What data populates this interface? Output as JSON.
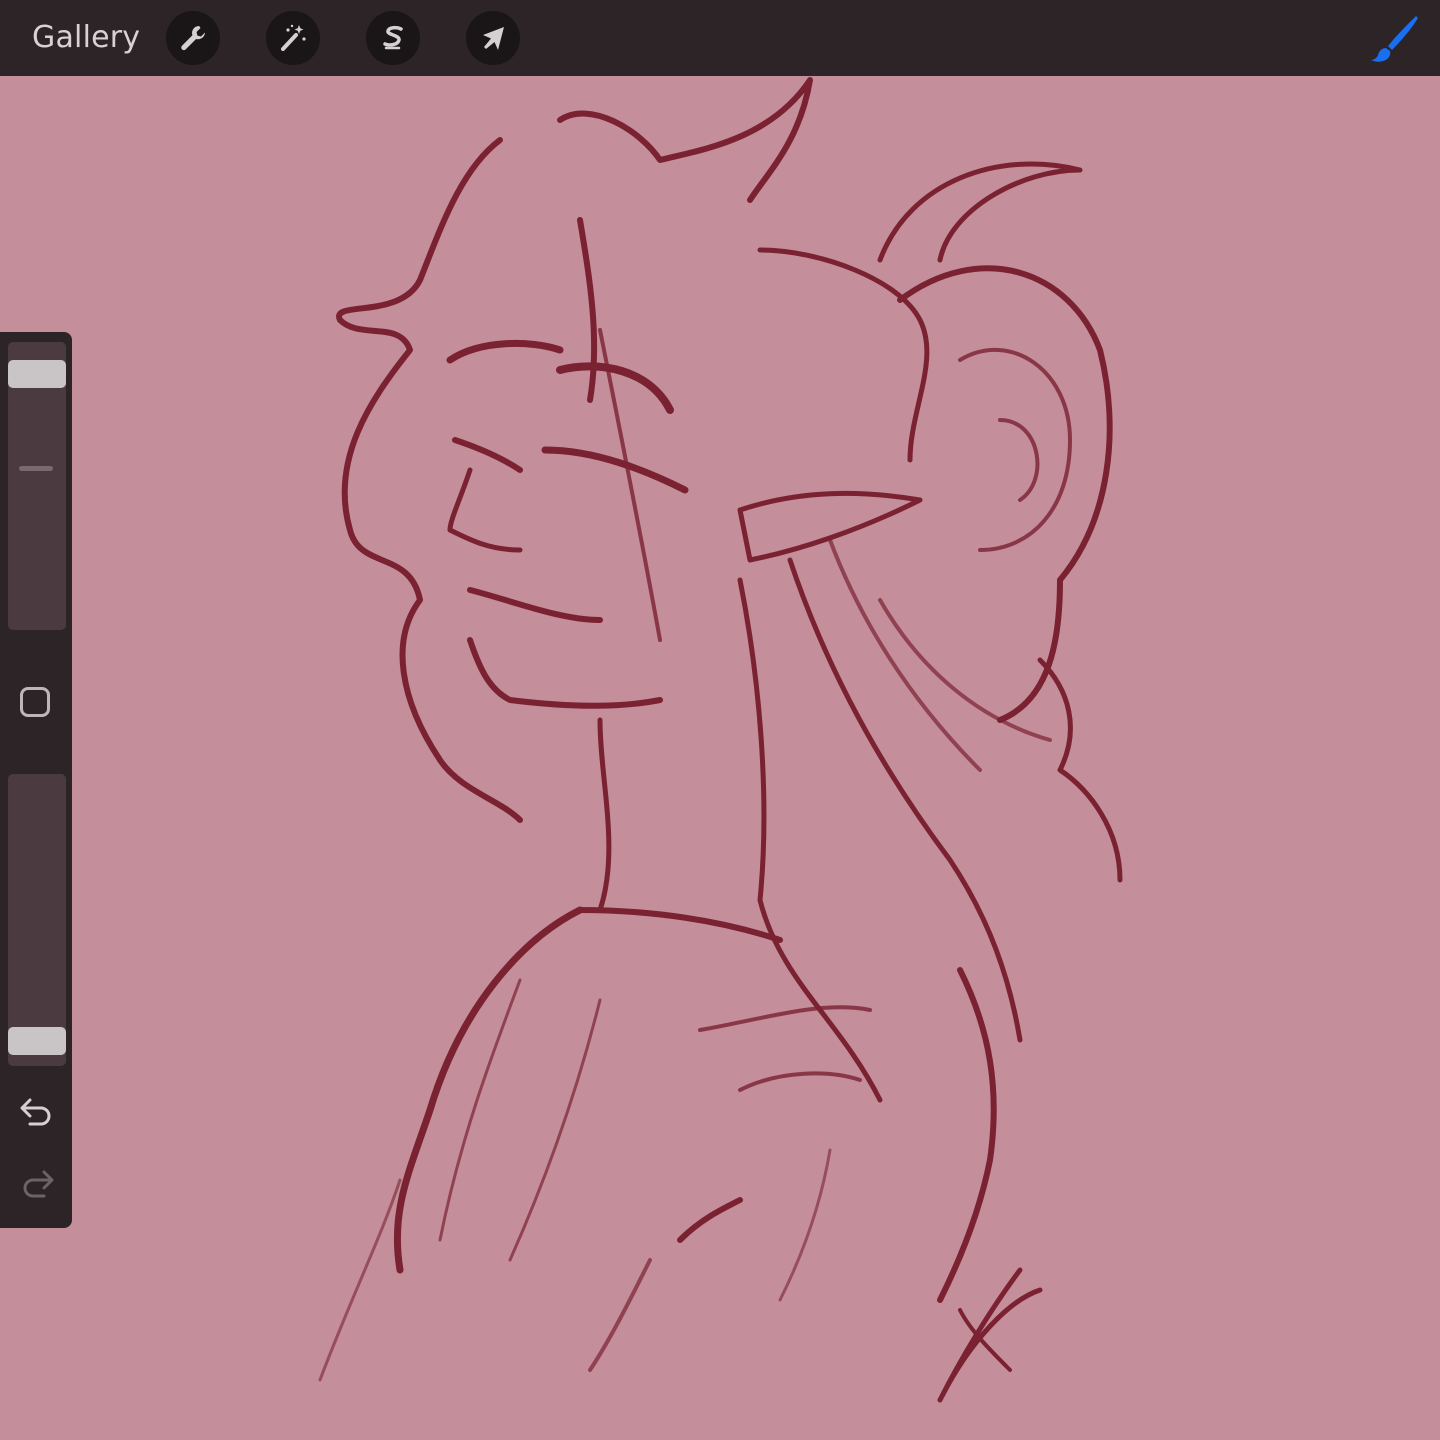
{
  "toolbar": {
    "gallery_label": "Gallery",
    "tools": [
      {
        "name": "actions",
        "icon": "wrench-icon"
      },
      {
        "name": "adjustments",
        "icon": "magic-wand-icon"
      },
      {
        "name": "selection",
        "icon": "selection-s-icon"
      },
      {
        "name": "transform",
        "icon": "arrow-cursor-icon"
      }
    ],
    "active_tool_icon": "brush-icon",
    "active_tool_color": "#1a6ff0"
  },
  "sidebar": {
    "brush_size_level": 0.93,
    "opacity_level": 0.04,
    "modifier_icon": "square-modifier-icon",
    "undo_icon": "undo-icon",
    "redo_icon": "redo-icon"
  },
  "canvas": {
    "paper_color": "#c48e9a",
    "ink_color": "#7a2232"
  }
}
